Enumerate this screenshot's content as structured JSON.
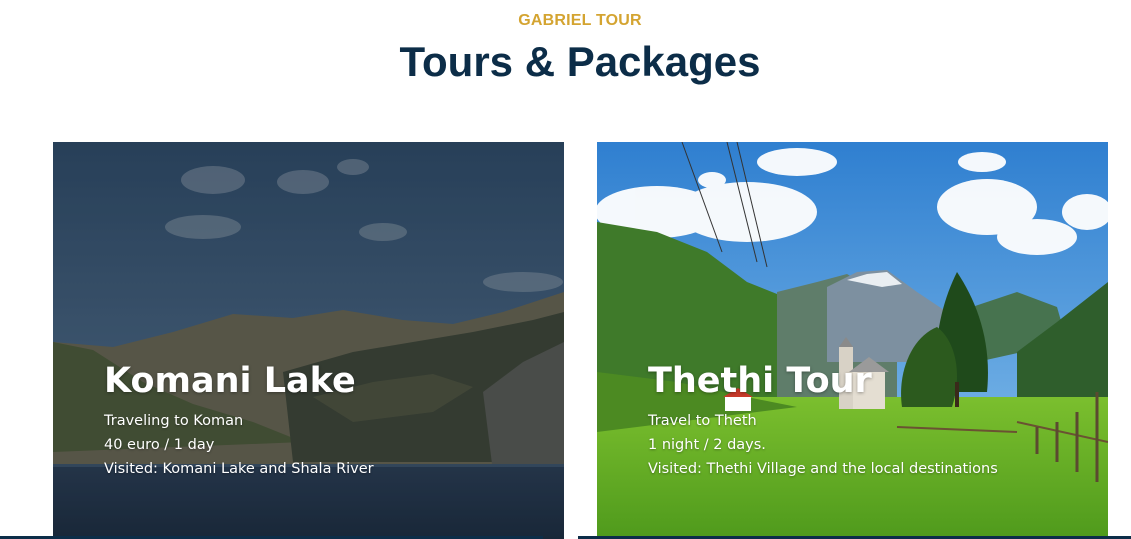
{
  "header": {
    "eyebrow": "GABRIEL TOUR",
    "title": "Tours & Packages"
  },
  "colors": {
    "accent": "#d4a431",
    "heading": "#0c2d48",
    "card_text": "#ffffff"
  },
  "cards": [
    {
      "name": "Komani Lake",
      "lines": [
        "Traveling to Koman",
        "40 euro / 1 day",
        "Visited: Komani Lake and Shala River"
      ],
      "image": "mountain-lake-photo"
    },
    {
      "name": "Thethi Tour",
      "lines": [
        "Travel to Theth",
        "1 night / 2 days.",
        "Visited: Thethi Village and the local destinations"
      ],
      "image": "alpine-village-church-photo"
    }
  ]
}
